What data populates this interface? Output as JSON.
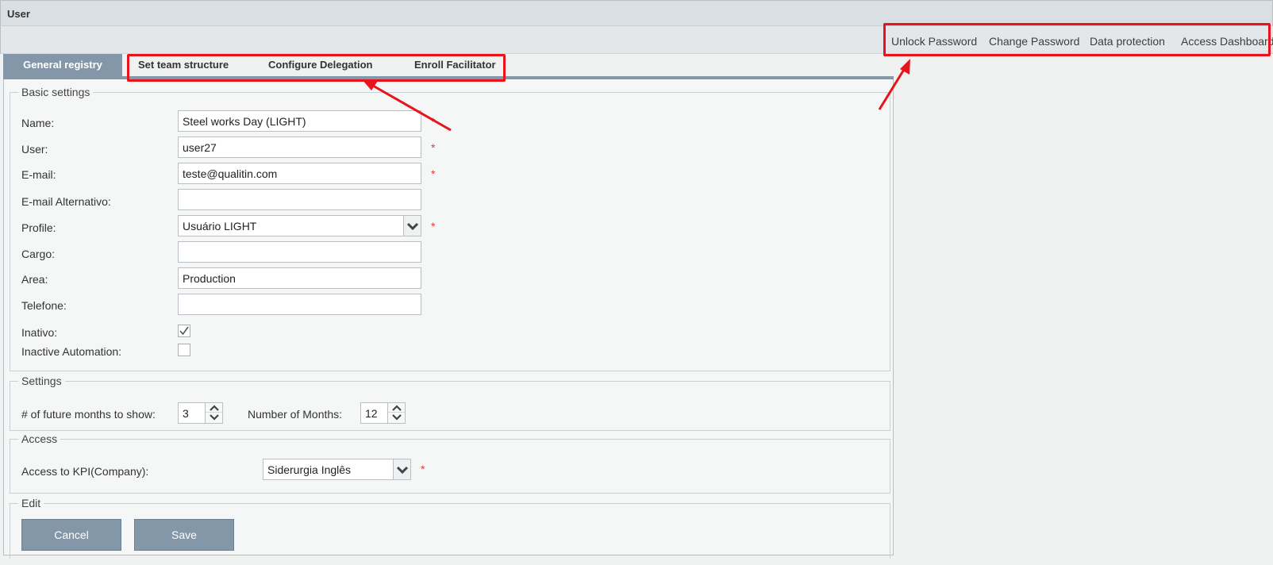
{
  "window": {
    "title": "User"
  },
  "actions": [
    {
      "label": "Unlock Password"
    },
    {
      "label": "Change Password"
    },
    {
      "label": "Data protection"
    },
    {
      "label": "Access Dashboard"
    }
  ],
  "tabs": [
    {
      "label": "General registry",
      "active": true
    },
    {
      "label": "Set team structure"
    },
    {
      "label": "Configure Delegation"
    },
    {
      "label": "Enroll Facilitator"
    }
  ],
  "basic": {
    "legend": "Basic settings",
    "name": {
      "label": "Name:",
      "value": "Steel works Day (LIGHT)",
      "required": "*"
    },
    "user": {
      "label": "User:",
      "value": "user27",
      "required": "*"
    },
    "email": {
      "label": "E-mail:",
      "value": "teste@qualitin.com",
      "required": "*"
    },
    "email_alt": {
      "label": "E-mail Alternativo:",
      "value": ""
    },
    "profile": {
      "label": "Profile:",
      "value": "Usuário LIGHT",
      "required": "*"
    },
    "cargo": {
      "label": "Cargo:",
      "value": ""
    },
    "area": {
      "label": "Area:",
      "value": "Production"
    },
    "telefone": {
      "label": "Telefone:",
      "value": ""
    },
    "inativo": {
      "label": "Inativo:",
      "checked": true
    },
    "inactive_automation": {
      "label": "Inactive Automation:",
      "checked": false
    }
  },
  "settings": {
    "legend": "Settings",
    "future_months": {
      "label": "# of future months to show:",
      "value": "3"
    },
    "number_months": {
      "label": "Number of Months:",
      "value": "12"
    }
  },
  "access": {
    "legend": "Access",
    "kpi": {
      "label": "Access to KPI(Company):",
      "value": "Siderurgia Inglês",
      "required": "*"
    }
  },
  "edit": {
    "legend": "Edit",
    "cancel_label": "Cancel",
    "save_label": "Save"
  },
  "colors": {
    "accent": "#8497a8",
    "highlight": "#e8131b",
    "required": "#e03a3a"
  }
}
